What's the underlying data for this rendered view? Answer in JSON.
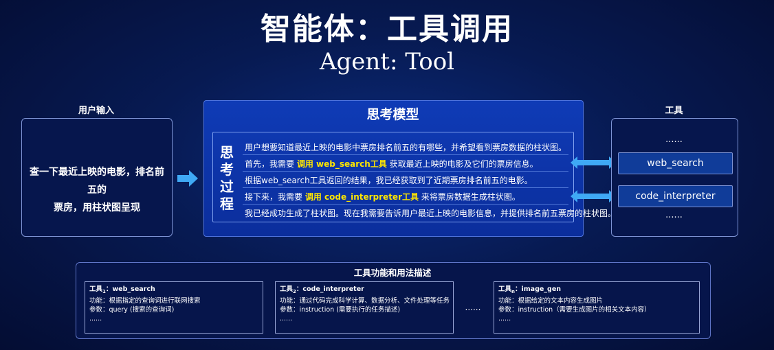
{
  "title": "智能体：工具调用",
  "subtitle": "Agent: Tool",
  "user_input": {
    "label": "用户输入",
    "text_line1": "查一下最近上映的电影，排名前五的",
    "text_line2": "票房，用柱状图呈现"
  },
  "model": {
    "title": "思考模型",
    "process_label": [
      "思",
      "考",
      "过",
      "程"
    ],
    "steps": [
      {
        "pre": "用户想要知道最近上映的电影中票房排名前五的有哪些，并希望看到票房数据的柱状图。",
        "hl": "",
        "post": ""
      },
      {
        "pre": "首先，我需要 ",
        "hl": "调用 web_search工具",
        "post": " 获取最近上映的电影及它们的票房信息。"
      },
      {
        "pre": "根据web_search工具返回的结果，我已经获取到了近期票房排名前五的电影。",
        "hl": "",
        "post": ""
      },
      {
        "pre": "接下来，我需要 ",
        "hl": "调用 code_interpreter工具",
        "post": " 来将票房数据生成柱状图。"
      },
      {
        "pre": "我已经成功生成了柱状图。现在我需要告诉用户最近上映的电影信息，并提供排名前五票房的柱状图。",
        "hl": "",
        "post": ""
      }
    ]
  },
  "tools": {
    "label": "工具",
    "dots_top": "......",
    "items": [
      "web_search",
      "code_interpreter"
    ],
    "dots_bottom": "......"
  },
  "bottom": {
    "title": "工具功能和用法描述",
    "between_dots": "......",
    "cards": [
      {
        "head_a": "工具",
        "sub": "1",
        "head_b": "：web_search",
        "func": "功能：根据指定的查询词进行联网搜索",
        "param": "参数：query (搜索的查询词)",
        "more": "......"
      },
      {
        "head_a": "工具",
        "sub": "2",
        "head_b": "：code_interpreter",
        "func": "功能：通过代码完成科学计算、数据分析、文件处理等任务",
        "param": "参数：instruction (需要执行的任务描述)",
        "more": "......"
      },
      {
        "head_a": "工具",
        "sub": "n",
        "head_b": "：image_gen",
        "func": "功能：根据给定的文本内容生成图片",
        "param": "参数：instruction（需要生成图片的相关文本内容）",
        "more": "......"
      }
    ]
  }
}
